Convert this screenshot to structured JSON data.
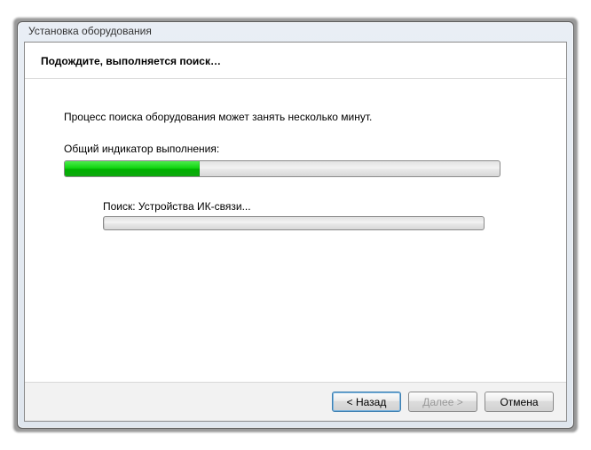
{
  "window": {
    "title": "Установка оборудования"
  },
  "header": {
    "title": "Подождите, выполняется поиск…"
  },
  "content": {
    "info": "Процесс поиска оборудования может занять несколько минут.",
    "progress_label": "Общий индикатор выполнения:",
    "progress_percent": 31,
    "sub_label": "Поиск: Устройства ИК-связи...",
    "sub_progress_percent": 0
  },
  "buttons": {
    "back": "< Назад",
    "next": "Далее >",
    "cancel": "Отмена"
  }
}
